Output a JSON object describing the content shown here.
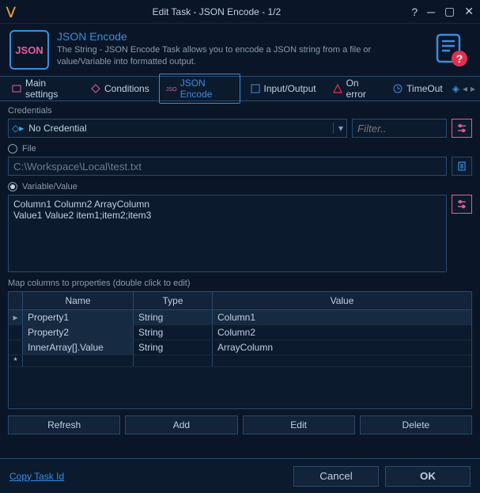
{
  "window": {
    "title": "Edit Task - JSON Encode - 1/2",
    "logo_glyph": "⋁"
  },
  "header": {
    "icon_text": "JSON",
    "title": "JSON Encode",
    "description": "The String - JSON Encode Task allows you to encode a JSON string from a file or value/Variable into formatted output."
  },
  "tabs": {
    "items": [
      {
        "label": "Main settings"
      },
      {
        "label": "Conditions"
      },
      {
        "label": "JSON Encode"
      },
      {
        "label": "Input/Output"
      },
      {
        "label": "On error"
      },
      {
        "label": "TimeOut"
      }
    ],
    "active_index": 2
  },
  "credentials": {
    "label": "Credentials",
    "selected": "No Credential",
    "filter_placeholder": "Filter.."
  },
  "source": {
    "file_label": "File",
    "file_path": "C:\\Workspace\\Local\\test.txt",
    "variable_label": "Variable/Value",
    "variable_value": "Column1 Column2 ArrayColumn\nValue1 Value2 item1;item2;item3",
    "selected": "variable"
  },
  "mapping": {
    "label": "Map columns to properties (double click to edit)",
    "columns": {
      "name": "Name",
      "type": "Type",
      "value": "Value"
    },
    "rows": [
      {
        "name": "Property1",
        "type": "String",
        "value": "Column1"
      },
      {
        "name": "Property2",
        "type": "String",
        "value": "Column2"
      },
      {
        "name": "InnerArray[].Value",
        "type": "String",
        "value": "ArrayColumn"
      }
    ],
    "actions": {
      "refresh": "Refresh",
      "add": "Add",
      "edit": "Edit",
      "delete": "Delete"
    }
  },
  "footer": {
    "copy_link": "Copy Task Id",
    "cancel": "Cancel",
    "ok": "OK"
  }
}
